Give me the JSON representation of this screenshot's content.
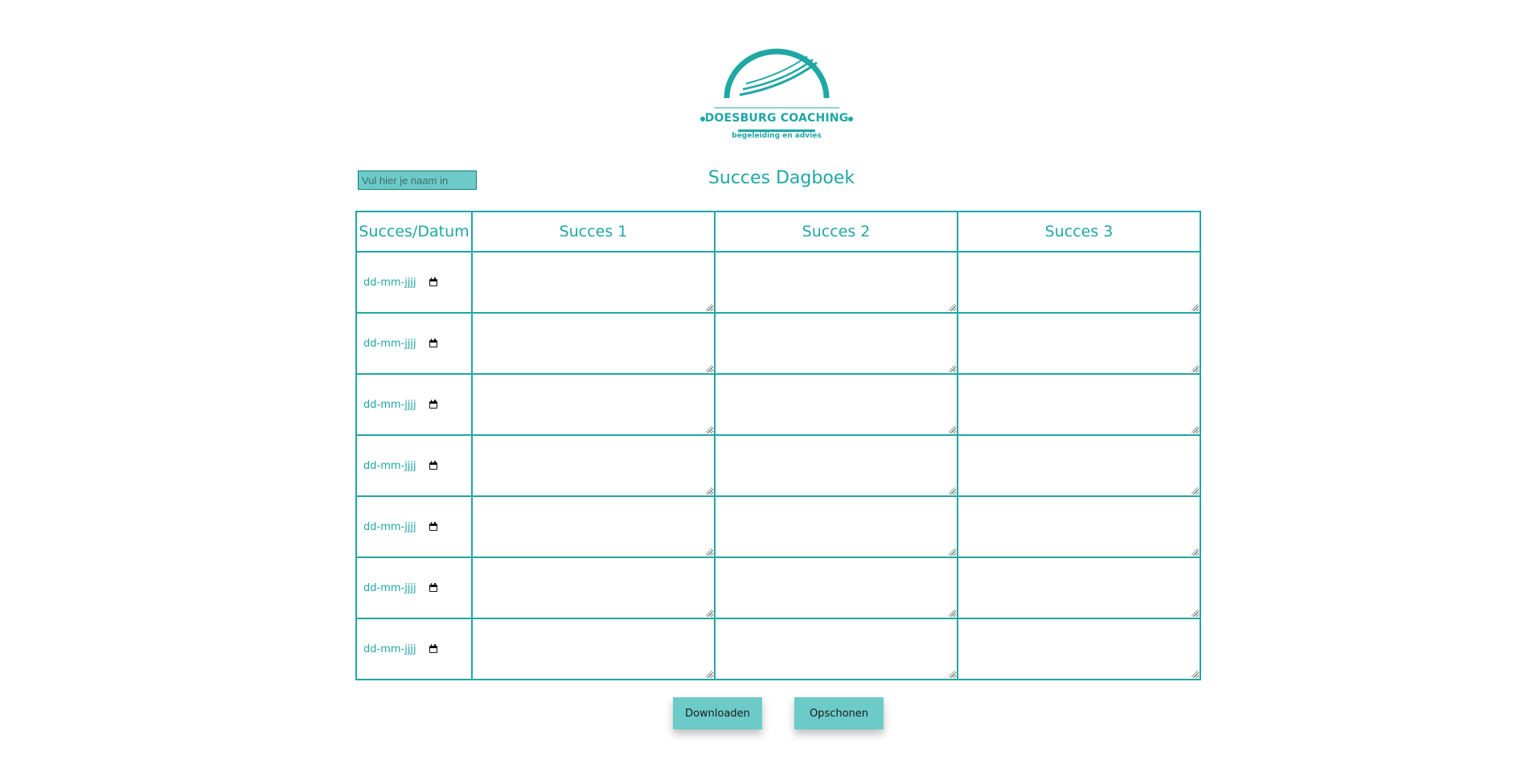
{
  "logo": {
    "brand": "DOESBURG COACHING",
    "tagline": "begeleiding en advies",
    "color": "#1fa7a5"
  },
  "name_input": {
    "placeholder": "Vul hier je naam in",
    "value": ""
  },
  "title": "Succes Dagboek",
  "table": {
    "headers": [
      "Succes/Datum",
      "Succes 1",
      "Succes 2",
      "Succes 3"
    ],
    "rows": [
      {
        "date_placeholder": "dd-mm-jjjj"
      },
      {
        "date_placeholder": "dd-mm-jjjj"
      },
      {
        "date_placeholder": "dd-mm-jjjj"
      },
      {
        "date_placeholder": "dd-mm-jjjj"
      },
      {
        "date_placeholder": "dd-mm-jjjj"
      },
      {
        "date_placeholder": "dd-mm-jjjj"
      },
      {
        "date_placeholder": "dd-mm-jjjj"
      }
    ]
  },
  "buttons": {
    "download": "Downloaden",
    "clear": "Opschonen"
  },
  "colors": {
    "accent": "#1fa7a5",
    "button_bg": "#6ccbc8"
  },
  "icons": {
    "date_picker": "calendar-icon"
  }
}
